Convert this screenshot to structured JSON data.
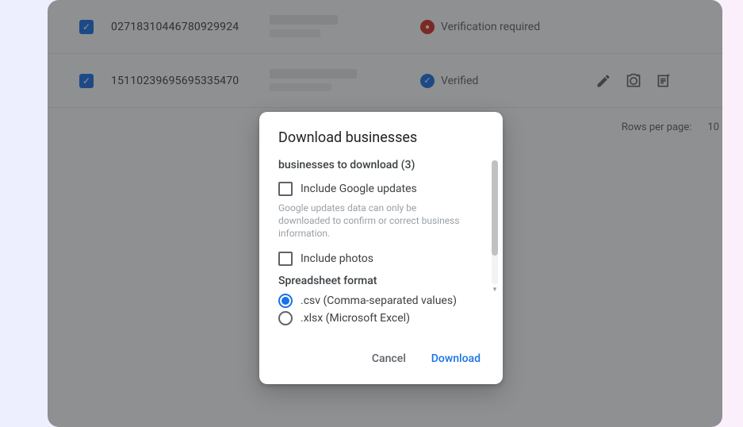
{
  "table": {
    "rows": [
      {
        "id": "02718310446780929924",
        "status": "Verification required",
        "status_kind": "required",
        "has_actions": false
      },
      {
        "id": "15110239695695335470",
        "status": "Verified",
        "status_kind": "verified",
        "has_actions": true
      }
    ],
    "footer": {
      "rows_per_page_label": "Rows per page:",
      "rows_per_page_value": "10"
    }
  },
  "modal": {
    "title": "Download businesses",
    "subheading": "businesses to download (3)",
    "include_google_updates": {
      "label": "Include Google updates",
      "hint": "Google updates data can only be downloaded to confirm or correct business information.",
      "checked": false
    },
    "include_photos": {
      "label": "Include photos",
      "checked": false
    },
    "format_section_label": "Spreadsheet format",
    "formats": {
      "csv": ".csv (Comma-separated values)",
      "xlsx": ".xlsx (Microsoft Excel)",
      "selected": "csv"
    },
    "buttons": {
      "cancel": "Cancel",
      "download": "Download"
    }
  }
}
